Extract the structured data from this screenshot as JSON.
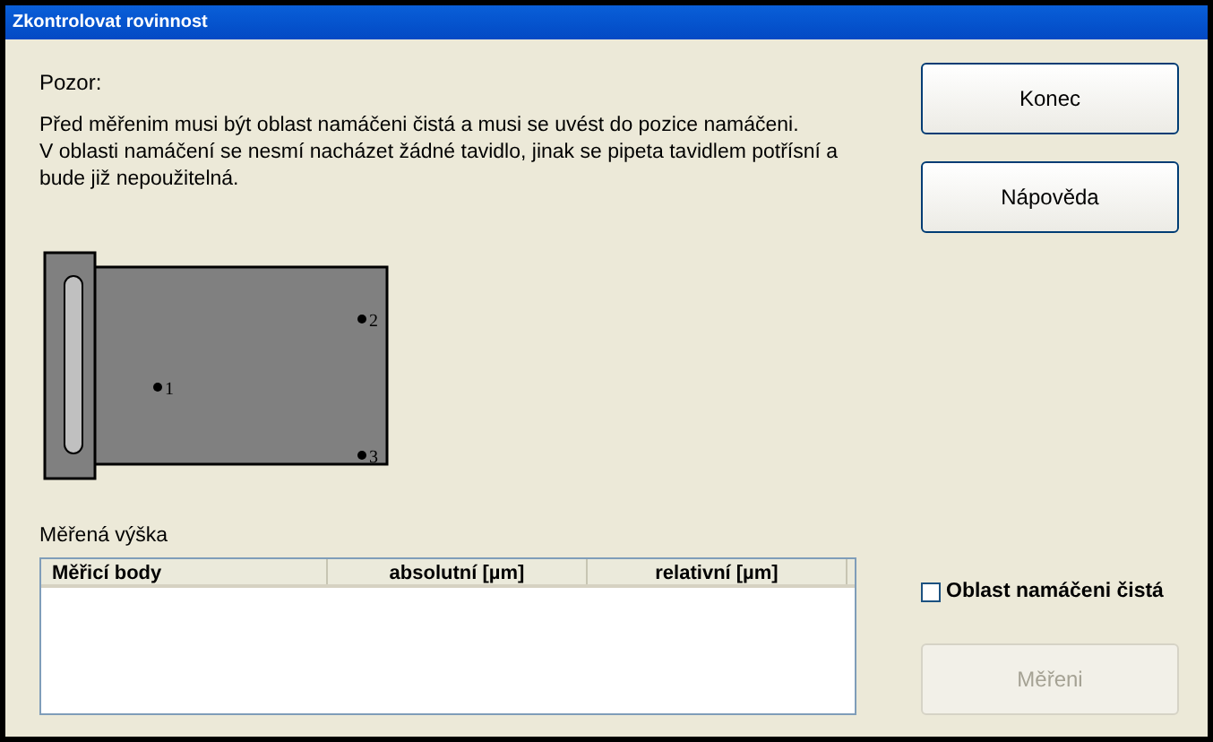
{
  "window": {
    "title": "Zkontrolovat rovinnost"
  },
  "warning": {
    "heading": "Pozor:",
    "text": "Před měřenim musi být oblast namáčeni čistá a musi se uvést do pozice namáčeni.\nV oblasti namáčení se nesmí nacházet žádné tavidlo, jinak se pipeta tavidlem potřísní a bude již nepoužitelná."
  },
  "diagram": {
    "points": [
      {
        "label": "1"
      },
      {
        "label": "2"
      },
      {
        "label": "3"
      }
    ]
  },
  "measured": {
    "label": "Měřená výška",
    "columns": [
      "Měřicí body",
      "absolutní [µm]",
      "relativní [µm]"
    ]
  },
  "buttons": [
    {
      "label": "Konec",
      "disabled": false
    },
    {
      "label": "Nápověda",
      "disabled": false
    }
  ],
  "clean_checkbox": {
    "label": "Oblast namáčeni čistá",
    "checked": false
  },
  "measure_button": {
    "label": "Měřeni",
    "disabled": true
  }
}
